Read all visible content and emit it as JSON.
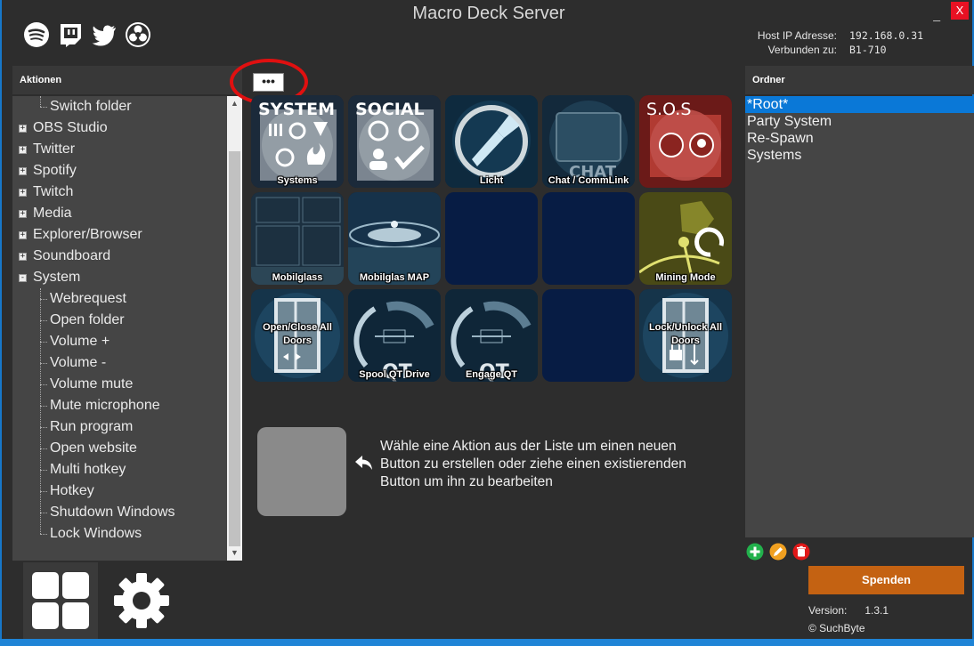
{
  "window": {
    "title": "Macro Deck Server",
    "close_label": "X",
    "minimize_label": "_"
  },
  "host": {
    "ip_label": "Host IP Adresse:",
    "ip_value": "192.168.0.31",
    "connected_label": "Verbunden zu:",
    "connected_value": "B1-710"
  },
  "social_icons": [
    "spotify-icon",
    "twitch-icon",
    "twitter-icon",
    "obs-icon"
  ],
  "actions_panel": {
    "header": "Aktionen",
    "items": [
      {
        "label": "Switch folder",
        "level": 1,
        "expand": ""
      },
      {
        "label": "OBS Studio",
        "level": 0,
        "expand": "+"
      },
      {
        "label": "Twitter",
        "level": 0,
        "expand": "+"
      },
      {
        "label": "Spotify",
        "level": 0,
        "expand": "+"
      },
      {
        "label": "Twitch",
        "level": 0,
        "expand": "+"
      },
      {
        "label": "Media",
        "level": 0,
        "expand": "+"
      },
      {
        "label": "Explorer/Browser",
        "level": 0,
        "expand": "+"
      },
      {
        "label": "Soundboard",
        "level": 0,
        "expand": "+"
      },
      {
        "label": "System",
        "level": 0,
        "expand": "-"
      },
      {
        "label": "Webrequest",
        "level": 1,
        "expand": ""
      },
      {
        "label": "Open folder",
        "level": 1,
        "expand": ""
      },
      {
        "label": "Volume +",
        "level": 1,
        "expand": ""
      },
      {
        "label": "Volume -",
        "level": 1,
        "expand": ""
      },
      {
        "label": "Volume mute",
        "level": 1,
        "expand": ""
      },
      {
        "label": "Mute microphone",
        "level": 1,
        "expand": ""
      },
      {
        "label": "Run program",
        "level": 1,
        "expand": ""
      },
      {
        "label": "Open website",
        "level": 1,
        "expand": ""
      },
      {
        "label": "Multi hotkey",
        "level": 1,
        "expand": ""
      },
      {
        "label": "Hotkey",
        "level": 1,
        "expand": ""
      },
      {
        "label": "Shutdown Windows",
        "level": 1,
        "expand": ""
      },
      {
        "label": "Lock Windows",
        "level": 1,
        "expand": ""
      }
    ]
  },
  "toolbar": {
    "more_label": "•••"
  },
  "deck_buttons": [
    {
      "label": "Systems",
      "art": "system",
      "art_text": "SYSTEM",
      "pos": "bottom"
    },
    {
      "label": "",
      "art": "social",
      "art_text": "SOCIAL",
      "pos": "bottom"
    },
    {
      "label": "Licht",
      "art": "light",
      "art_text": "",
      "pos": "bottom"
    },
    {
      "label": "Chat / CommLink",
      "art": "chat",
      "art_text": "CHAT",
      "pos": "bottom"
    },
    {
      "label": "",
      "art": "sos",
      "art_text": "S.O.S",
      "pos": "bottom"
    },
    {
      "label": "Mobilglass",
      "art": "mobi",
      "art_text": "",
      "pos": "bottom"
    },
    {
      "label": "Mobilglas MAP",
      "art": "map",
      "art_text": "",
      "pos": "bottom"
    },
    {
      "label": "",
      "art": "empty",
      "art_text": "",
      "pos": "bottom"
    },
    {
      "label": "",
      "art": "empty",
      "art_text": "",
      "pos": "bottom"
    },
    {
      "label": "Mining Mode",
      "art": "mining",
      "art_text": "",
      "pos": "bottom"
    },
    {
      "label": "Open/Close All Doors",
      "art": "door",
      "art_text": "",
      "pos": "mid"
    },
    {
      "label": "Spool QT Drive",
      "art": "qt",
      "art_text": "QT",
      "pos": "bottom"
    },
    {
      "label": "Engage QT",
      "art": "qt",
      "art_text": "QT",
      "pos": "bottom"
    },
    {
      "label": "",
      "art": "empty",
      "art_text": "",
      "pos": "bottom"
    },
    {
      "label": "Lock/Unlock All Doors",
      "art": "lockdoor",
      "art_text": "",
      "pos": "mid"
    }
  ],
  "hint": {
    "text": "Wähle eine Aktion aus der Liste um einen neuen Button zu erstellen oder ziehe einen existierenden Button um ihn zu bearbeiten"
  },
  "folders_panel": {
    "header": "Ordner",
    "items": [
      {
        "label": "*Root*",
        "selected": true
      },
      {
        "label": "Party System",
        "selected": false
      },
      {
        "label": "Re-Spawn",
        "selected": false
      },
      {
        "label": "Systems",
        "selected": false
      }
    ]
  },
  "folder_actions": {
    "add_color": "#22b14c",
    "edit_color": "#f0a020",
    "delete_color": "#e01818"
  },
  "donate": {
    "label": "Spenden",
    "color": "#c46212"
  },
  "version": {
    "label": "Version:",
    "value": "1.3.1"
  },
  "copyright": "© SuchByte"
}
